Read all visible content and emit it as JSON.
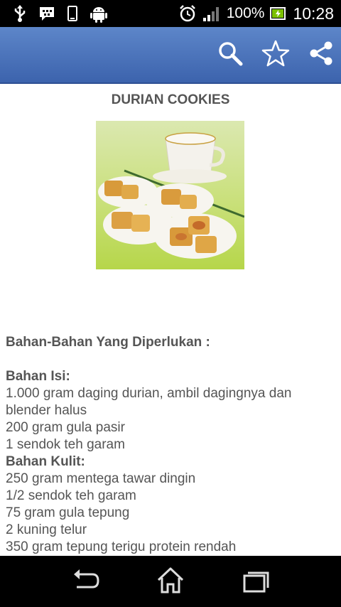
{
  "status_bar": {
    "battery_percent": "100%",
    "time": "10:28",
    "icons": [
      "usb-icon",
      "bbm-icon",
      "phone-icon",
      "android-icon",
      "alarm-icon",
      "signal-icon",
      "battery-icon"
    ]
  },
  "action_bar": {
    "icons": [
      "search-icon",
      "star-icon",
      "share-icon"
    ],
    "color": "#4a70b8"
  },
  "recipe": {
    "title": "DURIAN COOKIES",
    "heading": "Bahan-Bahan Yang Diperlukan :",
    "isi_label": "Bahan Isi:",
    "isi_items": [
      "1.000 gram daging durian, ambil dagingnya dan blender halus",
      "200 gram gula pasir",
      "1 sendok teh garam"
    ],
    "kulit_label": "Bahan Kulit:",
    "kulit_items": [
      "250 gram mentega tawar dingin",
      "1/2 sendok teh garam",
      "75 gram gula tepung",
      "2 kuning telur",
      "350 gram tepung terigu protein rendah"
    ]
  },
  "nav_bar": {
    "icons": [
      "back-icon",
      "home-icon",
      "recent-apps-icon"
    ]
  }
}
